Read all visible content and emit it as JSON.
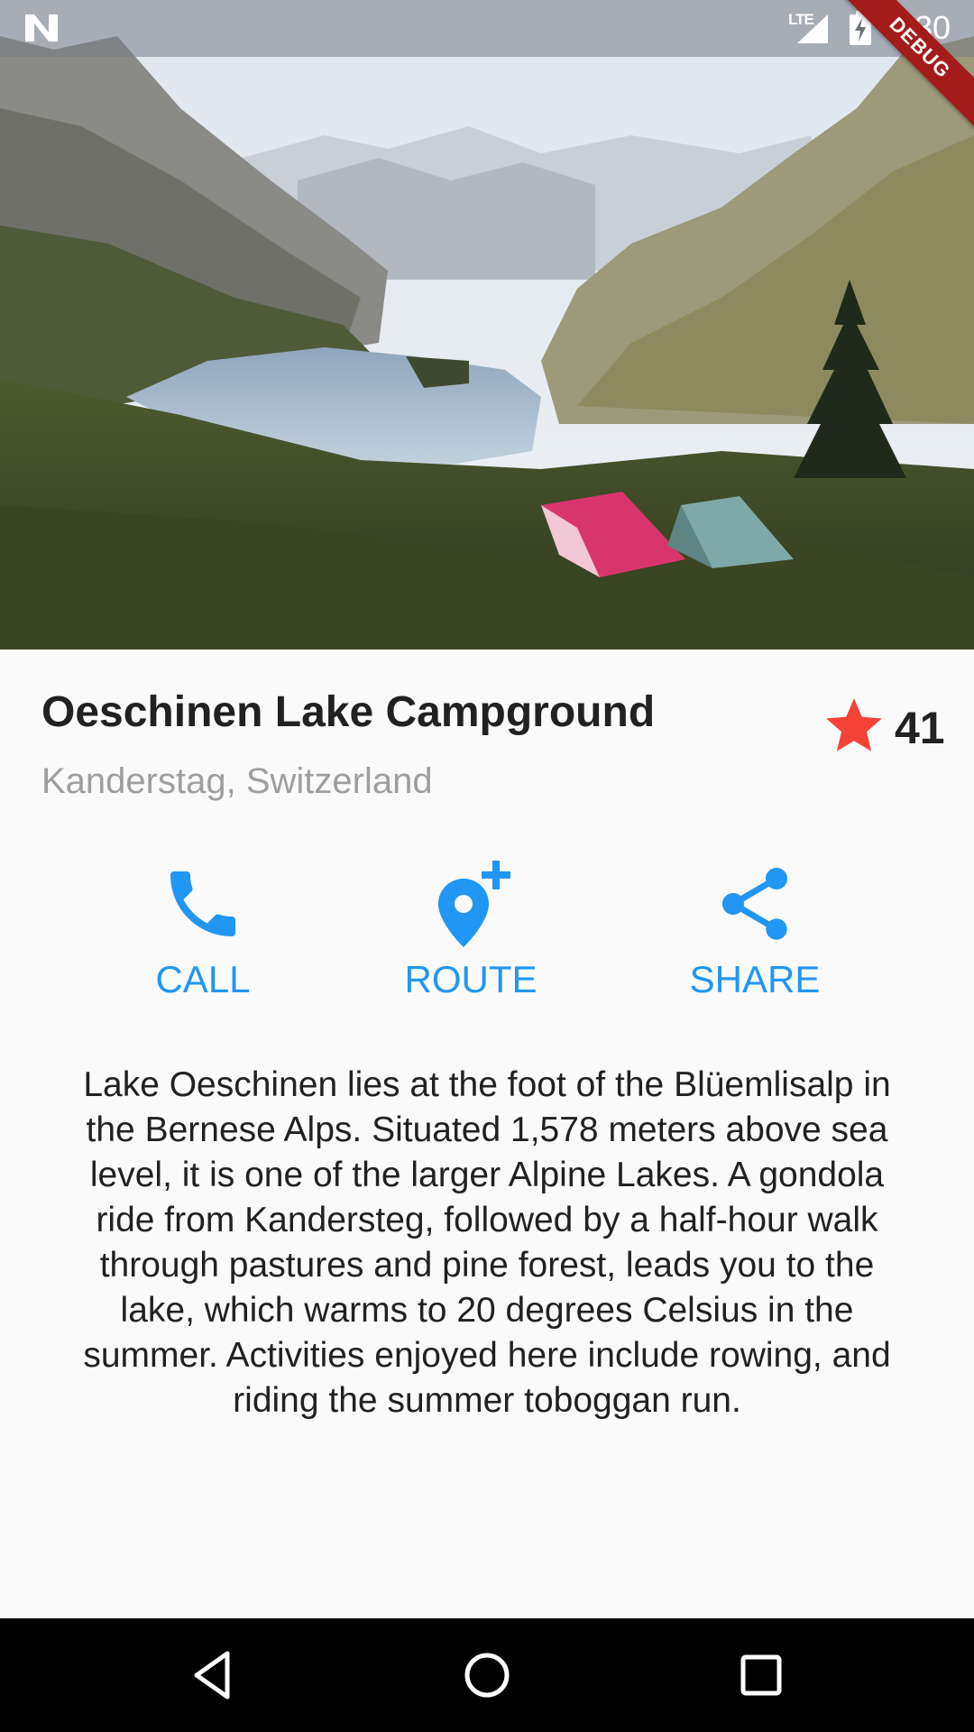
{
  "status_bar": {
    "network": "LTE",
    "time": "3:30"
  },
  "debug_banner": "DEBUG",
  "place": {
    "title": "Oeschinen Lake Campground",
    "subtitle": "Kanderstag, Switzerland",
    "favorite_count": "41"
  },
  "actions": [
    {
      "label": "CALL",
      "icon": "phone-icon"
    },
    {
      "label": "ROUTE",
      "icon": "add-location-icon"
    },
    {
      "label": "SHARE",
      "icon": "share-icon"
    }
  ],
  "description": "Lake Oeschinen lies at the foot of the Blüemlisalp in the Bernese Alps. Situated 1,578 meters above sea level, it is one of the larger Alpine Lakes. A gondola ride from Kandersteg, followed by a half-hour walk through pastures and pine forest, leads you to the lake, which warms to 20 degrees Celsius in the summer. Activities enjoyed here include rowing, and riding the summer toboggan run.",
  "colors": {
    "accent": "#2196f3",
    "star": "#f44336",
    "title": "#212121",
    "subtitle": "#9e9e9e",
    "debug_ribbon": "#a31b1b"
  }
}
